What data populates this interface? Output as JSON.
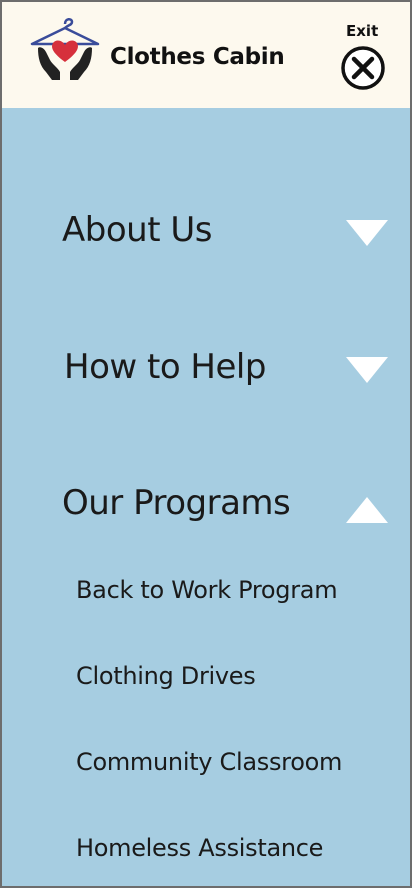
{
  "header": {
    "brand": "Clothes Cabin",
    "exit_label": "Exit",
    "logo_icon": "hanger-heart-hands-logo",
    "exit_icon": "close-circle-icon"
  },
  "menu": {
    "items": [
      {
        "label": "About Us",
        "expanded": false,
        "icon": "triangle-down-icon"
      },
      {
        "label": "How to Help",
        "expanded": false,
        "icon": "triangle-down-icon"
      },
      {
        "label": "Our Programs",
        "expanded": true,
        "icon": "triangle-up-icon",
        "children": [
          {
            "label": "Back to Work Program"
          },
          {
            "label": "Clothing Drives"
          },
          {
            "label": "Community Classroom"
          },
          {
            "label": "Homeless Assistance"
          }
        ]
      }
    ]
  },
  "colors": {
    "header_bg": "#fdf9ee",
    "menu_bg": "#a6cde1",
    "chevron": "#ffffff",
    "heart": "#d6303c",
    "hanger": "#3a4c9a"
  }
}
